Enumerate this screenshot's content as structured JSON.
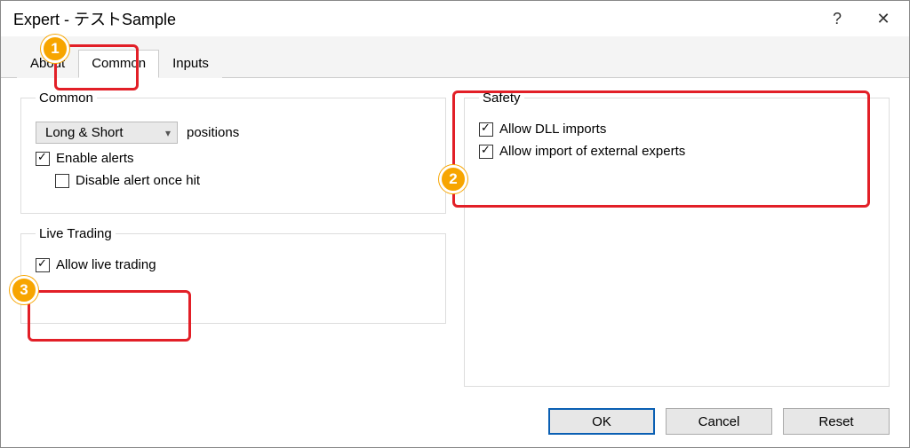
{
  "window": {
    "title": "Expert - テストSample",
    "help_tooltip": "?",
    "close_tooltip": "Close"
  },
  "tabs": [
    {
      "label": "About",
      "active": false
    },
    {
      "label": "Common",
      "active": true
    },
    {
      "label": "Inputs",
      "active": false
    }
  ],
  "common": {
    "legend": "Common",
    "positions_select": "Long & Short",
    "positions_label": "positions",
    "enable_alerts": {
      "label": "Enable alerts",
      "checked": true
    },
    "disable_alert_once_hit": {
      "label": "Disable alert once hit",
      "checked": false
    }
  },
  "live_trading": {
    "legend": "Live Trading",
    "allow_live_trading": {
      "label": "Allow live trading",
      "checked": true
    }
  },
  "safety": {
    "legend": "Safety",
    "allow_dll": {
      "label": "Allow DLL imports",
      "checked": true
    },
    "allow_external_experts": {
      "label": "Allow import of external experts",
      "checked": true
    }
  },
  "buttons": {
    "ok": "OK",
    "cancel": "Cancel",
    "reset": "Reset"
  },
  "annotations": {
    "badge1": "1",
    "badge2": "2",
    "badge3": "3"
  }
}
